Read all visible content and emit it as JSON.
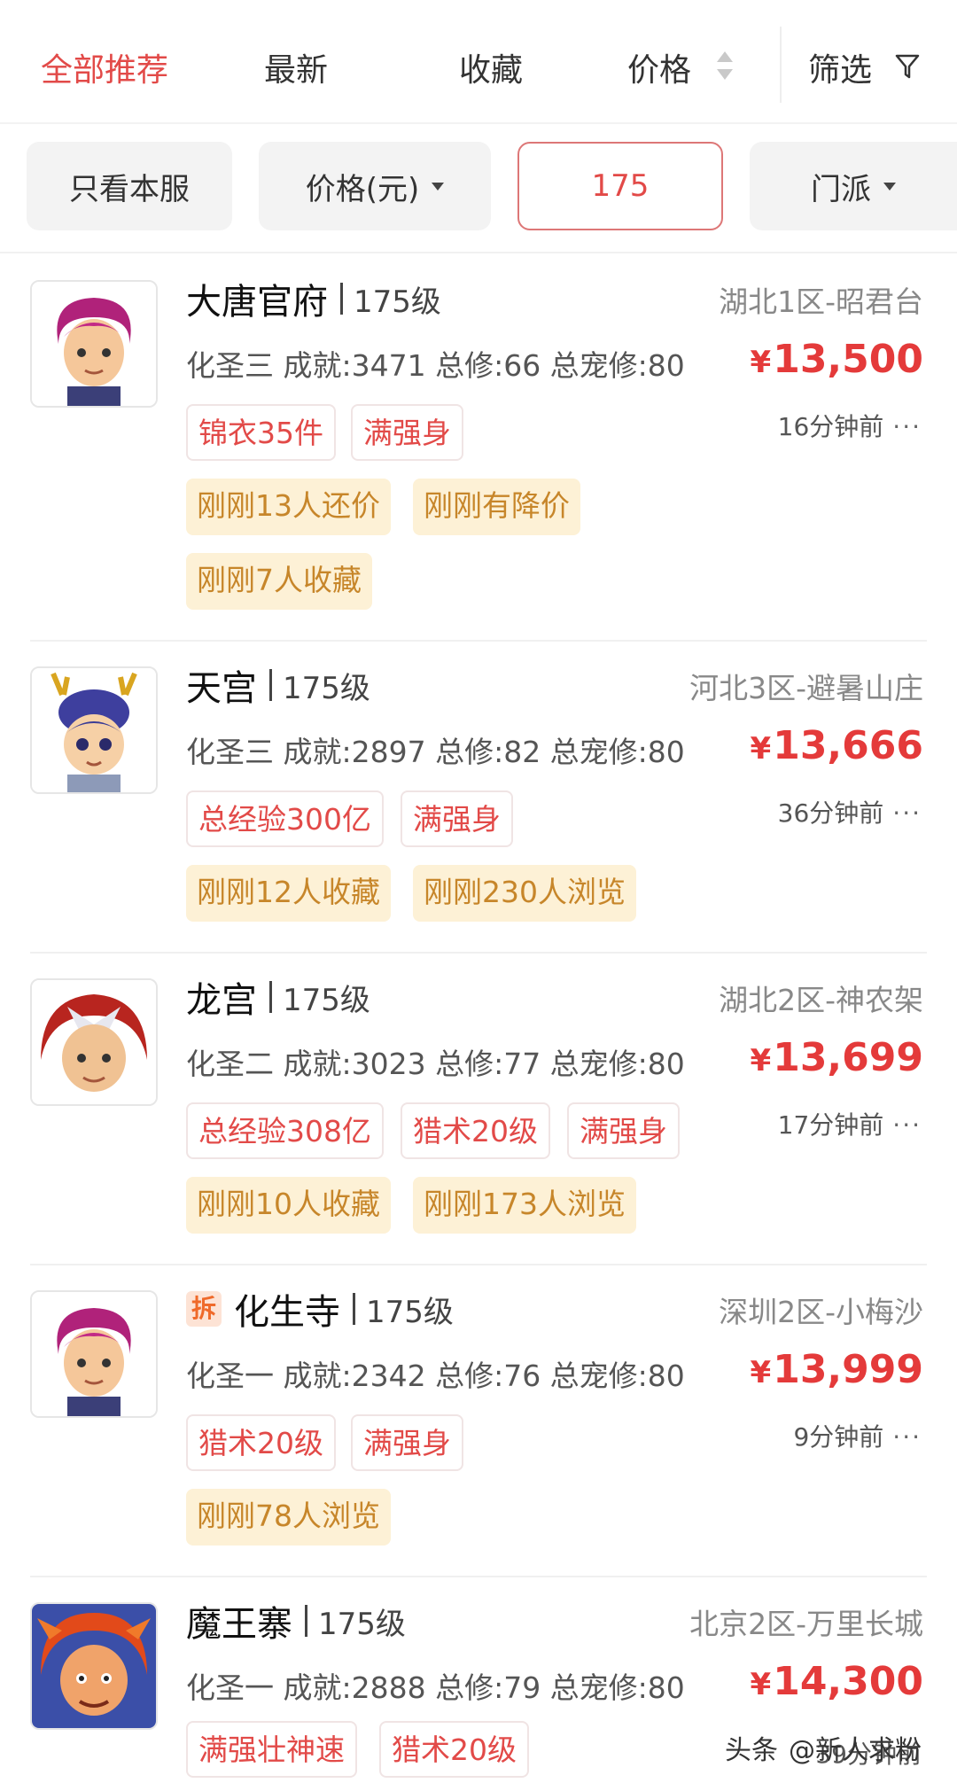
{
  "sort_tabs": [
    {
      "label": "全部推荐",
      "active": true
    },
    {
      "label": "最新",
      "active": false
    },
    {
      "label": "收藏",
      "active": false
    },
    {
      "label": "价格",
      "active": false
    }
  ],
  "filter_label": "筛选",
  "filters": {
    "server_only": "只看本服",
    "price": "价格(元)",
    "level_value": "175",
    "school": "门派"
  },
  "listings": [
    {
      "school": "大唐官府",
      "level": "175级",
      "server": "湖北1区-昭君台",
      "stats": "化圣三 成就:3471 总修:66 总宠修:80",
      "price": "13,500",
      "time": "16分钟前",
      "badge": "",
      "red_tags": [
        "锦衣35件",
        "满强身"
      ],
      "gold_tags": [
        "刚刚13人还价",
        "刚刚有降价",
        "刚刚7人收藏"
      ]
    },
    {
      "school": "天宫",
      "level": "175级",
      "server": "河北3区-避暑山庄",
      "stats": "化圣三 成就:2897 总修:82 总宠修:80",
      "price": "13,666",
      "time": "36分钟前",
      "badge": "",
      "red_tags": [
        "总经验300亿",
        "满强身"
      ],
      "gold_tags": [
        "刚刚12人收藏",
        "刚刚230人浏览"
      ]
    },
    {
      "school": "龙宫",
      "level": "175级",
      "server": "湖北2区-神农架",
      "stats": "化圣二 成就:3023 总修:77 总宠修:80",
      "price": "13,699",
      "time": "17分钟前",
      "badge": "",
      "red_tags": [
        "总经验308亿",
        "猎术20级",
        "满强身"
      ],
      "gold_tags": [
        "刚刚10人收藏",
        "刚刚173人浏览"
      ]
    },
    {
      "school": "化生寺",
      "level": "175级",
      "server": "深圳2区-小梅沙",
      "stats": "化圣一 成就:2342 总修:76 总宠修:80",
      "price": "13,999",
      "time": "9分钟前",
      "badge": "拆",
      "red_tags": [
        "猎术20级",
        "满强身"
      ],
      "gold_tags": [
        "刚刚78人浏览"
      ]
    },
    {
      "school": "魔王寨",
      "level": "175级",
      "server": "北京2区-万里长城",
      "stats": "化圣一 成就:2888 总修:79 总宠修:80",
      "price": "14,300",
      "time": "39分钟前",
      "badge": "",
      "red_tags": [
        "满强壮神速",
        "猎术20级"
      ],
      "gold_tags": []
    }
  ],
  "currency_symbol": "¥",
  "more_symbol": "···",
  "watermark": {
    "source": "头条",
    "handle": "@新人求粉"
  },
  "colors": {
    "accent": "#e24a48",
    "price": "#e43a3a",
    "gold_tag_bg": "#fdf1d6",
    "gold_tag_text": "#c7862a"
  }
}
